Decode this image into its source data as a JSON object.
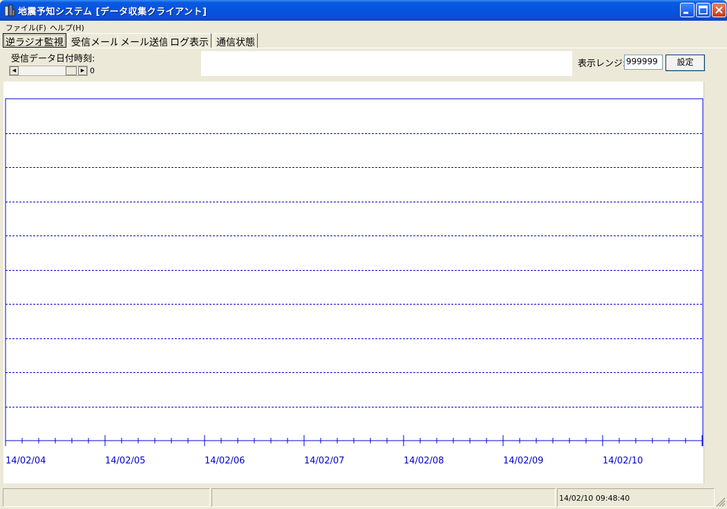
{
  "window": {
    "title": "地震予知システム [データ収集クライアント]"
  },
  "menu": [
    {
      "label": "ファイル(F)"
    },
    {
      "label": "ヘルプ(H)"
    }
  ],
  "tabs": [
    {
      "label": "逆ラジオ監視",
      "active": true
    },
    {
      "label": "受信メール",
      "active": false
    },
    {
      "label": "メール送信",
      "active": false
    },
    {
      "label": "ログ表示",
      "active": false
    },
    {
      "label": "通信状態",
      "active": false
    }
  ],
  "controls": {
    "received_date_label": "受信データ日付時刻:",
    "scroll_value": "0",
    "range_label": "表示レンジ:",
    "range_value": "999999",
    "set_button": "設定"
  },
  "chart_data": {
    "type": "line",
    "series": [],
    "x_tick_labels": [
      "14/02/04",
      "14/02/05",
      "14/02/06",
      "14/02/07",
      "14/02/08",
      "14/02/09",
      "14/02/10"
    ],
    "horizontal_gridlines": 9,
    "gridline_style": "dashed",
    "minor_ticks_per_day": 6,
    "colors": {
      "axis": "#0000cc",
      "labels": "#0000cc"
    }
  },
  "status_bar": {
    "panels": [
      "",
      "",
      "14/02/10 09:48:40"
    ]
  },
  "colors": {
    "titlebar": "#0553e0",
    "face": "#ece9d8",
    "chart_background": "#ffffff",
    "chart_lines": "#0000cc"
  }
}
